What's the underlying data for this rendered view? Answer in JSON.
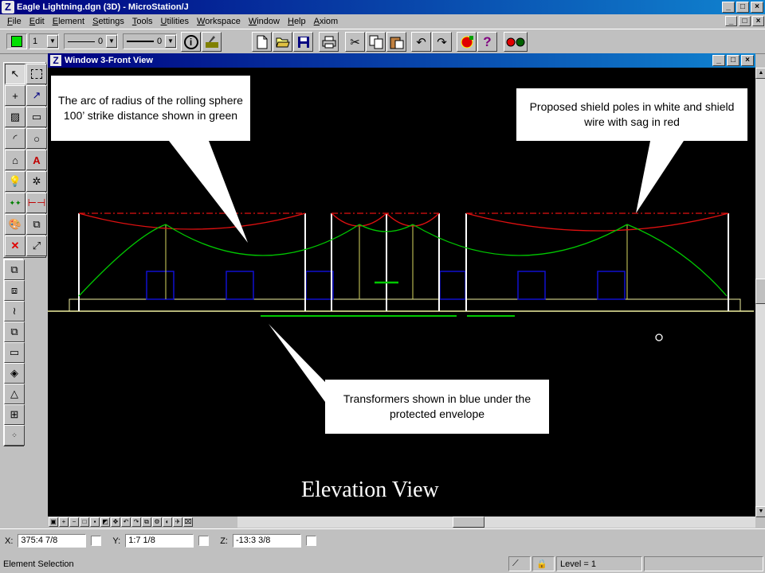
{
  "window": {
    "title": "Eagle Lightning.dgn (3D) - MicroStation/J",
    "app_icon": "Z"
  },
  "menu": [
    "File",
    "Edit",
    "Element",
    "Settings",
    "Tools",
    "Utilities",
    "Workspace",
    "Window",
    "Help",
    "Axiom"
  ],
  "toolbar": {
    "active_color": "#00e000",
    "level_value": "1",
    "line_style_value": "0",
    "line_weight_value": "0",
    "icons": [
      "info-icon",
      "key-in-icon",
      "new-file-icon",
      "open-folder-icon",
      "save-icon",
      "print-icon",
      "cut-icon",
      "copy-icon",
      "paste-icon",
      "undo-icon",
      "redo-icon",
      "stop-icon",
      "help-icon",
      "traffic-light-icon"
    ]
  },
  "view": {
    "title": "Window 3-Front View"
  },
  "callouts": {
    "arc": "The arc of radius of the rolling sphere 100’ strike distance shown in green",
    "shield": "Proposed shield poles in white and shield wire with sag in red",
    "transformers": "Transformers shown in blue under the protected envelope"
  },
  "caption": "Elevation View",
  "colors": {
    "arc": "#00c800",
    "shield_wire": "#e00000",
    "poles": "#ffffff",
    "transformers": "#0000c0",
    "structures": "#e8e870"
  },
  "coordinates": {
    "x_label": "X:",
    "x_value": "375:4  7/8",
    "y_label": "Y:",
    "y_value": "1:7  1/8",
    "z_label": "Z:",
    "z_value": "-13:3  3/8"
  },
  "status": {
    "prompt": "Element Selection",
    "level": "Level = 1"
  }
}
